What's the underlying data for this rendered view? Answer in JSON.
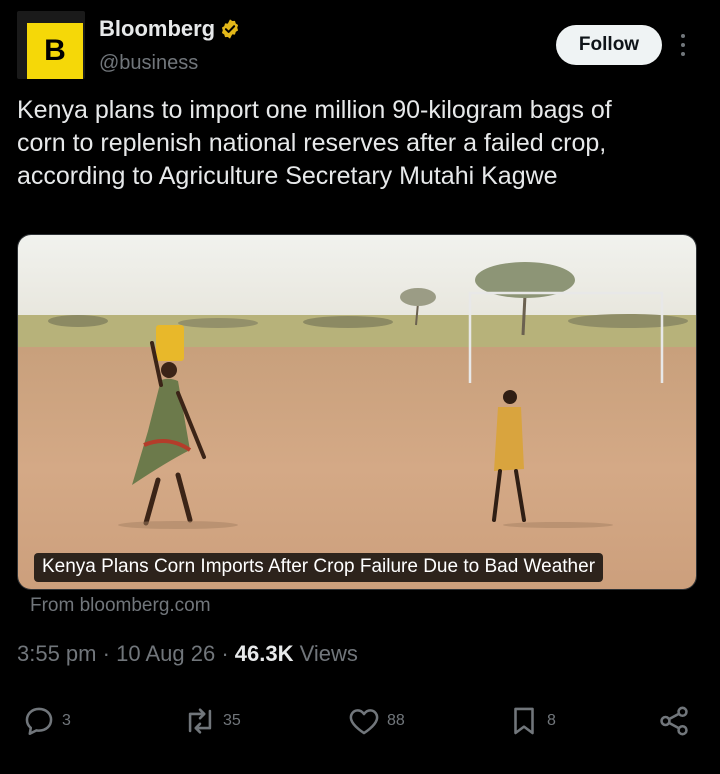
{
  "author": {
    "avatar_letter": "B",
    "display_name": "Bloomberg",
    "handle": "@business",
    "verified": "gold-verified-badge-icon"
  },
  "follow_label": "Follow",
  "tweet": {
    "lines": [
      "Kenya plans to import one million 90-kilogram bags of",
      "corn to replenish national reserves after a failed crop,",
      "according to Agriculture Secretary Mutahi Kagwe"
    ]
  },
  "card": {
    "title": "Kenya Plans Corn Imports After Crop Failure Due to Bad Weather",
    "source": "From bloomberg.com"
  },
  "meta": {
    "time": "3:55 pm",
    "date": "10 Aug 26",
    "views_count": "46.3K",
    "views_label": "Views",
    "separator": "·"
  },
  "actions": {
    "replies": "3",
    "reposts": "35",
    "likes": "88",
    "bookmarks": "8"
  },
  "colors": {
    "background": "#000000",
    "text": "#e7e9ea",
    "muted": "#71767b",
    "brand": "#f5d808",
    "verified_gold": "#e2b719"
  }
}
